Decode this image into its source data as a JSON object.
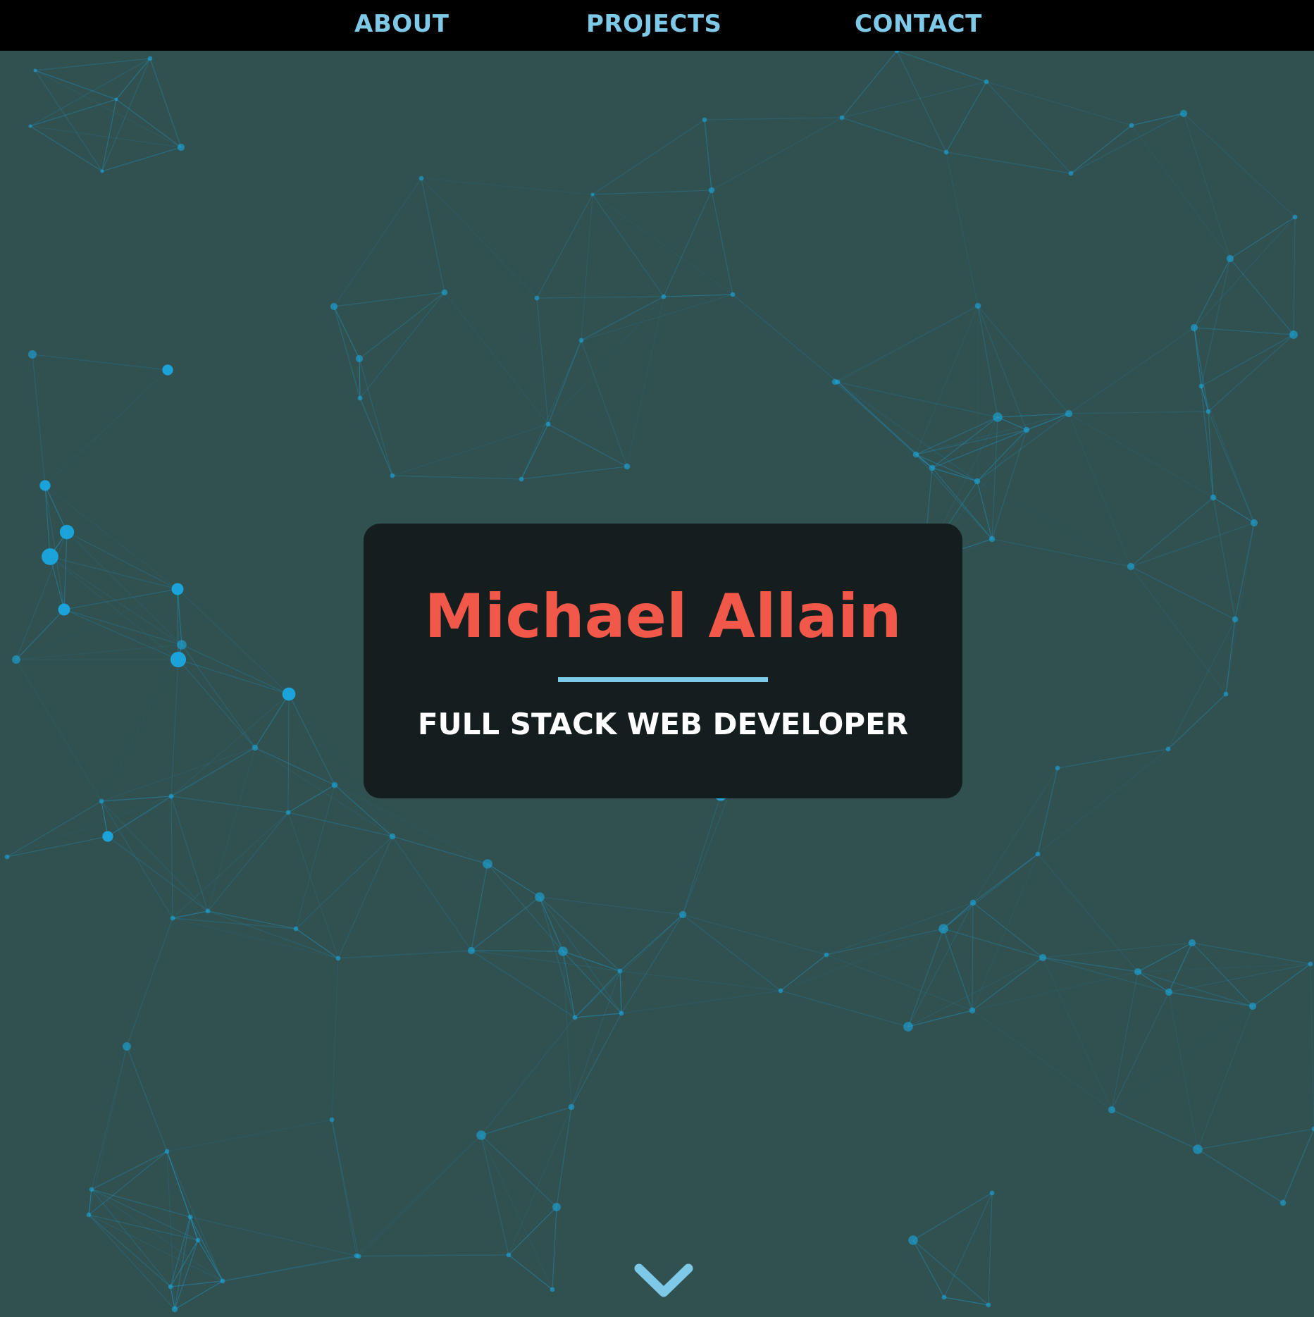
{
  "nav": {
    "items": [
      {
        "label": "ABOUT"
      },
      {
        "label": "PROJECTS"
      },
      {
        "label": "CONTACT"
      }
    ]
  },
  "hero": {
    "name": "Michael Allain",
    "subtitle": "FULL STACK WEB DEVELOPER"
  },
  "icons": {
    "scroll": "chevron-down-icon"
  },
  "colors": {
    "background": "#315050",
    "nav_background": "#000000",
    "accent": "#7ec8e8",
    "name": "#f1584a",
    "card": "#151e1f",
    "particle": "#1aa8e0"
  }
}
